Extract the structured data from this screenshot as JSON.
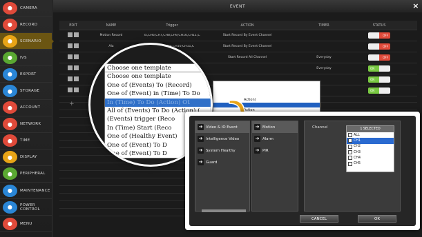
{
  "sidebar": {
    "items": [
      {
        "label": "CAMERA",
        "icon": "camera-icon",
        "color": "#e04a3a"
      },
      {
        "label": "RECORD",
        "icon": "record-icon",
        "color": "#e04a3a"
      },
      {
        "label": "SCENARIO",
        "icon": "scenario-icon",
        "color": "#e8a417",
        "active": true
      },
      {
        "label": "IVS",
        "icon": "ivs-icon",
        "color": "#5aa832"
      },
      {
        "label": "EXPORT",
        "icon": "export-icon",
        "color": "#2a86d6"
      },
      {
        "label": "STORAGE",
        "icon": "storage-icon",
        "color": "#2a86d6"
      },
      {
        "label": "ACCOUNT",
        "icon": "account-icon",
        "color": "#e04a3a"
      },
      {
        "label": "NETWORK",
        "icon": "network-icon",
        "color": "#e04a3a"
      },
      {
        "label": "TIME",
        "icon": "time-icon",
        "color": "#e04a3a"
      },
      {
        "label": "DISPLAY",
        "icon": "display-icon",
        "color": "#e8a417"
      },
      {
        "label": "PERIPHERAL",
        "icon": "peripheral-icon",
        "color": "#5aa832"
      },
      {
        "label": "MAINTENANCE",
        "icon": "maintenance-icon",
        "color": "#2a86d6"
      },
      {
        "label": "POWER CONTROL",
        "icon": "power-icon",
        "color": "#2a86d6"
      },
      {
        "label": "MENU",
        "icon": "menu-icon",
        "color": "#e04a3a"
      }
    ]
  },
  "header": {
    "title": "EVENT",
    "close": "×"
  },
  "table": {
    "headers": [
      "EDIT",
      "NAME",
      "Trigger",
      "ACTION",
      "TIMER",
      "STATUS"
    ],
    "rows": [
      {
        "name": "Motion Record",
        "trigger": "I5,CH6,CH7,CH8,CH9,CH10,CH11,C",
        "action": "Start Record By Event Channel",
        "timer": "",
        "status": "OFF"
      },
      {
        "name": "Ala",
        "trigger": "CH7,CH8,CH9,CH10,CH11,C",
        "action": "Start Record By Event Channel",
        "timer": "",
        "status": "OFF"
      },
      {
        "name": "",
        "trigger": "",
        "action": "Start Record All Channel",
        "timer": "Everyday",
        "status": "OFF"
      },
      {
        "name": "",
        "trigger": "",
        "action": "",
        "timer": "Everyday",
        "status": "ON"
      },
      {
        "name": "",
        "trigger": "",
        "action": "",
        "timer": "",
        "status": "ON"
      },
      {
        "name": "",
        "trigger": "",
        "action": "",
        "timer": "",
        "status": "ON"
      }
    ],
    "add": "+"
  },
  "bg_dropdown": {
    "text1": "Action)",
    "text2": "Action"
  },
  "template_list": {
    "items": [
      "Choose one template",
      "Choose one template",
      "One of (Events) To (Record)",
      "One of (Event) in (Time) To Do",
      "In (Time) To Do (Action) Ot",
      "All of (Events) To Do (Action) (",
      "(Events) trigger (Reco",
      "In (Time) Start (Reco",
      "One of (Healthy Event)",
      "One of (Event) To D",
      "One of (Event) To D"
    ],
    "highlighted": 4
  },
  "popup": {
    "col1": [
      "Video & IO Event",
      "Intelligence Video",
      "System Healthy",
      "Guard"
    ],
    "col2": [
      "Motion",
      "Alarm",
      "PIR"
    ],
    "channel_label": "Channel",
    "channel_selected": "1 SELECTED",
    "channels": [
      "ALL",
      "CH1",
      "CH2",
      "CH3",
      "CH4",
      "CH5"
    ],
    "cancel": "CANCEL",
    "ok": "OK"
  }
}
